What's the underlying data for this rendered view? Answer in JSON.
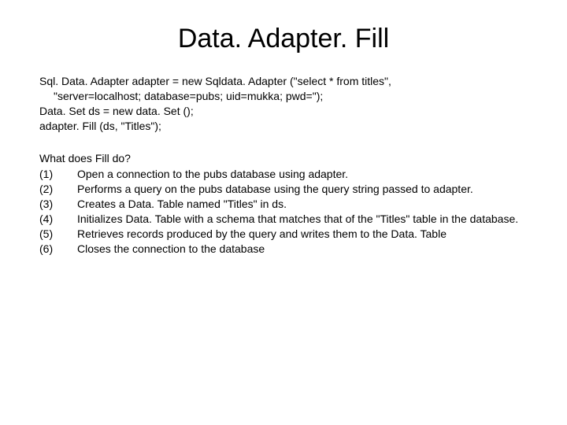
{
  "title": "Data. Adapter. Fill",
  "code": {
    "line1": "Sql. Data. Adapter adapter = new Sqldata. Adapter (\"select * from titles\",",
    "line2": "\"server=localhost; database=pubs; uid=mukka; pwd=\");",
    "line3": "Data. Set ds = new data. Set ();",
    "line4": "adapter. Fill (ds, \"Titles\");"
  },
  "description": {
    "heading": "What does Fill do?",
    "items": [
      {
        "num": "(1)",
        "text": "Open a connection to the pubs database using adapter."
      },
      {
        "num": "(2)",
        "text": "Performs  a query on the pubs database using the query string passed to adapter."
      },
      {
        "num": "(3)",
        "text": "Creates a Data. Table named \"Titles\" in ds."
      },
      {
        "num": "(4)",
        "text": "Initializes Data. Table with a schema that matches that of the \"Titles\" table in the database."
      },
      {
        "num": "(5)",
        "text": "Retrieves records produced by the query and writes them to the Data. Table"
      },
      {
        "num": "(6)",
        "text": "Closes the connection to the database"
      }
    ]
  }
}
